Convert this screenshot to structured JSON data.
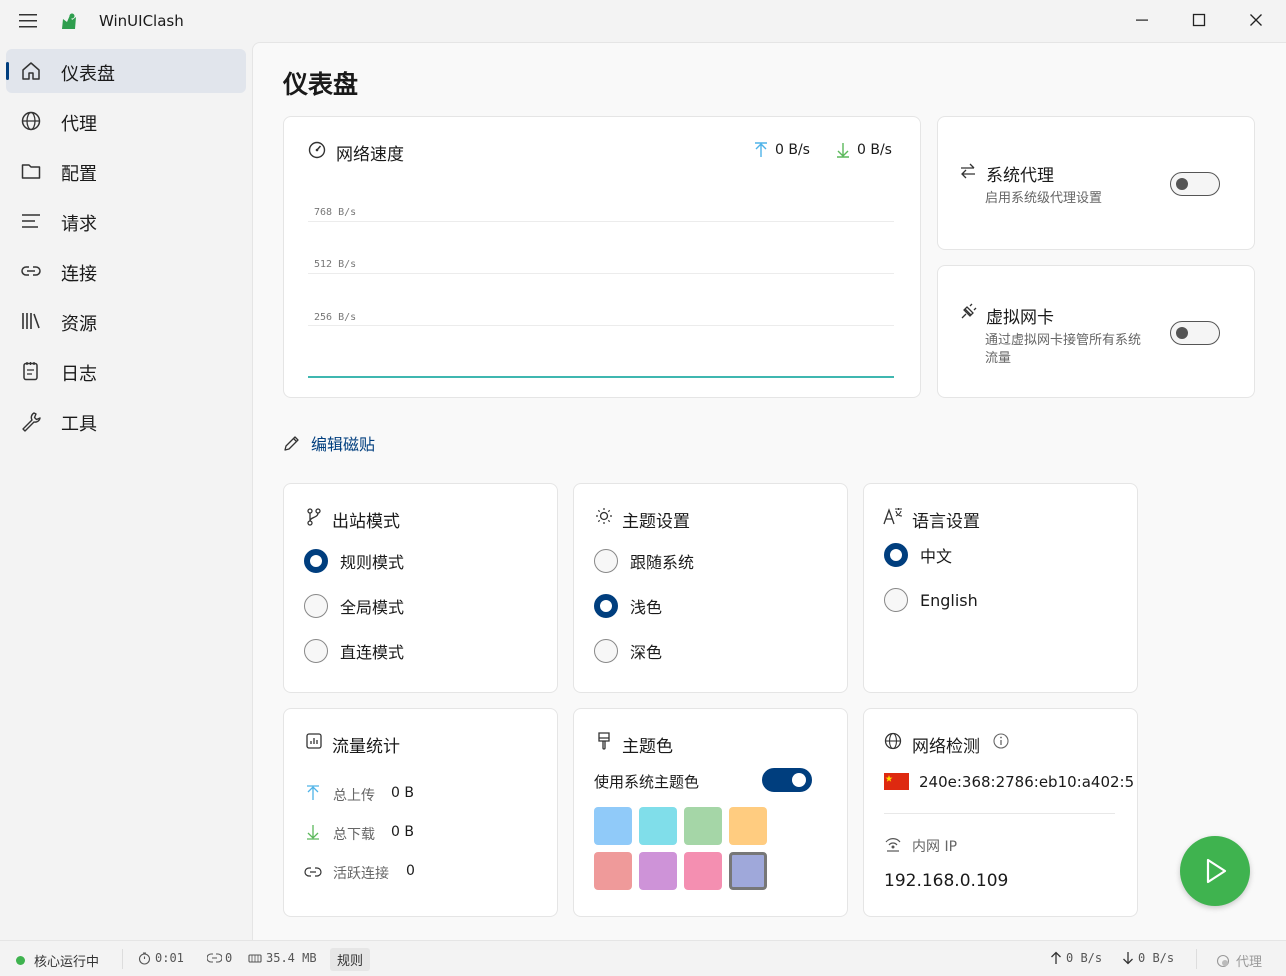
{
  "window": {
    "title": "WinUIClash"
  },
  "sidebar": {
    "items": [
      {
        "label": "仪表盘",
        "icon": "home-icon",
        "active": true
      },
      {
        "label": "代理",
        "icon": "globe-icon"
      },
      {
        "label": "配置",
        "icon": "folder-icon"
      },
      {
        "label": "请求",
        "icon": "list-icon"
      },
      {
        "label": "连接",
        "icon": "link-icon"
      },
      {
        "label": "资源",
        "icon": "library-icon"
      },
      {
        "label": "日志",
        "icon": "notepad-icon"
      },
      {
        "label": "工具",
        "icon": "wrench-icon"
      }
    ]
  },
  "main": {
    "title": "仪表盘",
    "speed": {
      "title": "网络速度",
      "upload": "0 B/s",
      "download": "0 B/s",
      "grid_labels": [
        "768 B/s",
        "512 B/s",
        "256 B/s"
      ]
    },
    "system_proxy": {
      "title": "系统代理",
      "desc": "启用系统级代理设置",
      "enabled": false
    },
    "tun": {
      "title": "虚拟网卡",
      "desc_line1": "通过虚拟网卡接管所有系统",
      "desc_line2": "流量",
      "enabled": false
    },
    "edit_tiles": "编辑磁贴",
    "outbound": {
      "title": "出站模式",
      "options": [
        "规则模式",
        "全局模式",
        "直连模式"
      ],
      "selected": 0
    },
    "theme": {
      "title": "主题设置",
      "options": [
        "跟随系统",
        "浅色",
        "深色"
      ],
      "selected": 1
    },
    "language": {
      "title": "语言设置",
      "options": [
        "中文",
        "English"
      ],
      "selected": 0
    },
    "traffic": {
      "title": "流量统计",
      "upload_label": "总上传",
      "upload_value": "0 B",
      "download_label": "总下载",
      "download_value": "0 B",
      "active_label": "活跃连接",
      "active_value": "0"
    },
    "theme_color": {
      "title": "主题色",
      "use_system_label": "使用系统主题色",
      "use_system": true,
      "swatches": [
        "#90caf9",
        "#80deea",
        "#a5d6a7",
        "#ffcc80",
        "#ef9a9a",
        "#ce93d8",
        "#f48fb1",
        "#9fa8da"
      ],
      "selected": 7
    },
    "network_check": {
      "title": "网络检测",
      "public_ip": "240e:368:2786:eb10:a402:5",
      "lan_label": "内网 IP",
      "lan_ip": "192.168.0.109"
    }
  },
  "status": {
    "core": "核心运行中",
    "uptime": "0:01",
    "connections": "0",
    "memory": "35.4 MB",
    "mode": "规则",
    "up": "0 B/s",
    "down": "0 B/s",
    "proxy": "代理"
  }
}
